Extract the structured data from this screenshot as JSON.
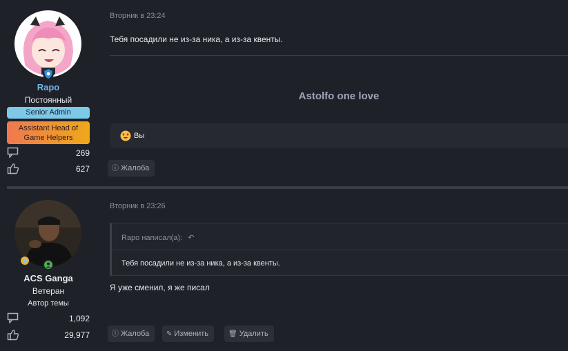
{
  "posts": [
    {
      "user": {
        "name": "Rapo",
        "user_title": "Постоянный",
        "banners": [
          "Senior Admin",
          "Assistant Head of Game Helpers"
        ],
        "messages": "269",
        "reactions": "627"
      },
      "date": "Вторник в 23:24",
      "text": "Тебя посадили не из-за ника, а из-за квенты.",
      "signature": "Astolfo one love",
      "reaction_label": "Вы",
      "buttons": {
        "report": "Жалоба"
      }
    },
    {
      "user": {
        "name": "ACS Ganga",
        "user_title": "Ветеран",
        "extra": "Автор темы",
        "messages": "1,092",
        "reactions": "29,977"
      },
      "date": "Вторник в 23:26",
      "quote": {
        "author": "Rapo написал(а):",
        "text": "Тебя посадили не из-за ника, а из-за квенты."
      },
      "text": "Я уже сменил, я же писал",
      "buttons": {
        "report": "Жалоба",
        "edit": "Изменить",
        "delete": "Удалить"
      }
    }
  ],
  "colors": {
    "background": "#1f2129",
    "senior_admin_banner": "#7ec8e8",
    "assistant_banner_gradient": [
      "#f07850",
      "#f0a818"
    ],
    "username_link": "#6fb6e8",
    "online": "#4caf50"
  }
}
